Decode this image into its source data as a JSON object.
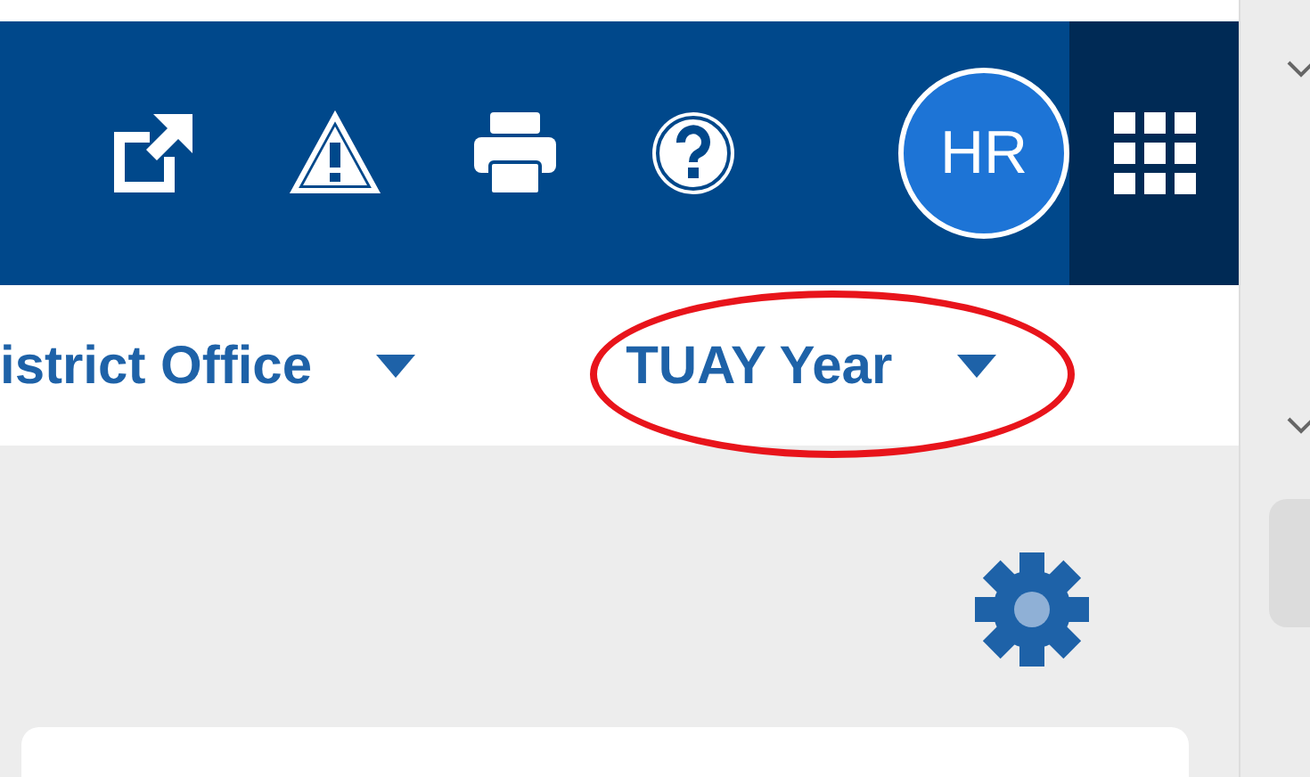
{
  "avatar": {
    "initials": "HR"
  },
  "filters": [
    {
      "label": "istrict Office",
      "highlighted": false
    },
    {
      "label": "TUAY Year",
      "highlighted": true
    }
  ]
}
